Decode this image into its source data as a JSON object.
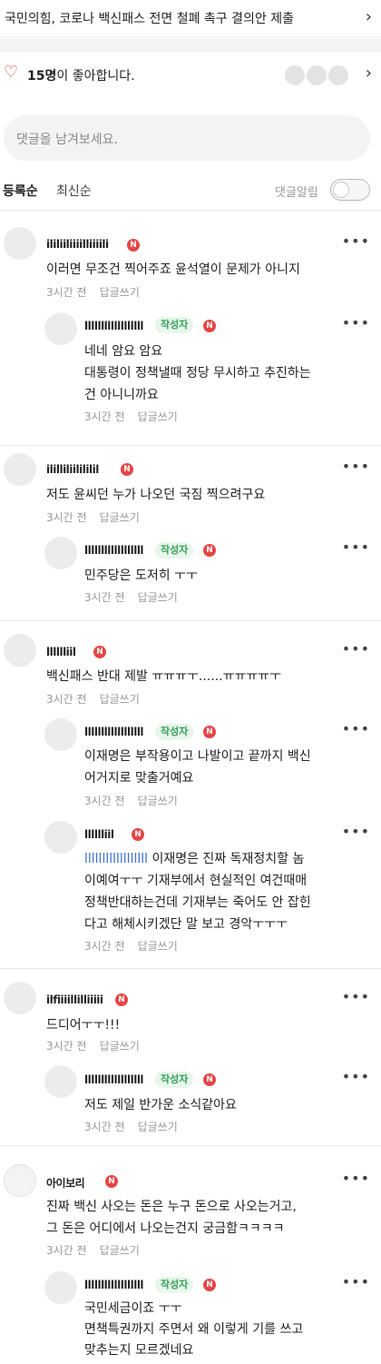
{
  "post": {
    "title": "국민의힘, 코로나 백신패스 전면 철폐 촉구 결의안 제출"
  },
  "likes": {
    "count_text": "15명",
    "suffix_text": "이 좋아합니다."
  },
  "comment_input": {
    "placeholder": "댓글을 남겨보세요."
  },
  "sort": {
    "registered": "등록순",
    "latest": "최신순",
    "notify_label": "댓글알림"
  },
  "badges": {
    "naver": "N",
    "author": "작성자"
  },
  "actions": {
    "reply": "답글쓰기"
  },
  "comments": [
    {
      "name": "ililiiliiiilliiiili",
      "text": [
        "이러면 무조건 찍어주죠 윤석열이 문제가 아니지"
      ],
      "time": "3시간 전",
      "replies": [
        {
          "name": "llllllllllllllllll",
          "author": true,
          "text": [
            "네네 암요 암요",
            "대통령이 정책낼때 정당 무시하고 추진하는",
            "건 아니니까요"
          ],
          "time": "3시간 전"
        }
      ]
    },
    {
      "name": "ililliliilililil",
      "text": [
        "저도 윤씨던 누가 나오던 국짐 찍으려구요"
      ],
      "time": "3시간 전",
      "replies": [
        {
          "name": "llllllllllllllllll",
          "author": true,
          "text": [
            "민주당은 도저히 ㅜㅜ"
          ],
          "time": "3시간 전"
        }
      ]
    },
    {
      "name": "lllllliil",
      "text": [
        "백신패스 반대 제발 ㅠㅠㅠㅜ......ㅠㅠㅠㅠㅜ"
      ],
      "time": "3시간 전",
      "replies": [
        {
          "name": "llllllllllllllllll",
          "author": true,
          "text": [
            "이재명은 부작용이고 나발이고 끝까지 백신",
            "어거지로 맞출거예요"
          ],
          "time": "3시간 전"
        },
        {
          "name": "lllllliil",
          "author": false,
          "mention": "llllllllllllllllll",
          "text": [
            " 이재명은 진짜 독재정치할 놈",
            "이예여ㅜㅜ 기재부에서 현실적인 여건때매",
            "정책반대하는건데 기재부는 죽어도 안 잡힌",
            "다고 해체시키겠단 말 보고 경악ㅜㅜㅜ"
          ],
          "time": "3시간 전"
        }
      ]
    },
    {
      "name": "ilfiiiillilliiiii",
      "text": [
        "드디어ㅜㅜ!!!"
      ],
      "time": "3시간 전",
      "replies": [
        {
          "name": "llllllllllllllllll",
          "author": true,
          "text": [
            "저도 제일 반가운 소식같아요"
          ],
          "time": "3시간 전"
        }
      ]
    },
    {
      "name": "아이보리",
      "text": [
        "진짜 백신 사오는 돈은 누구 돈으로 사오는거고,",
        "그 돈은 어디에서 나오는건지 궁금함ㅋㅋㅋㅋ"
      ],
      "time": "3시간 전",
      "replies": [
        {
          "name": "llllllllllllllllll",
          "author": true,
          "text": [
            "국민세금이죠 ㅜㅜ",
            "면책특권까지 주면서 왜 이렇게 기를 쓰고",
            "맞추는지 모르겠네요"
          ],
          "time": ""
        }
      ]
    }
  ]
}
